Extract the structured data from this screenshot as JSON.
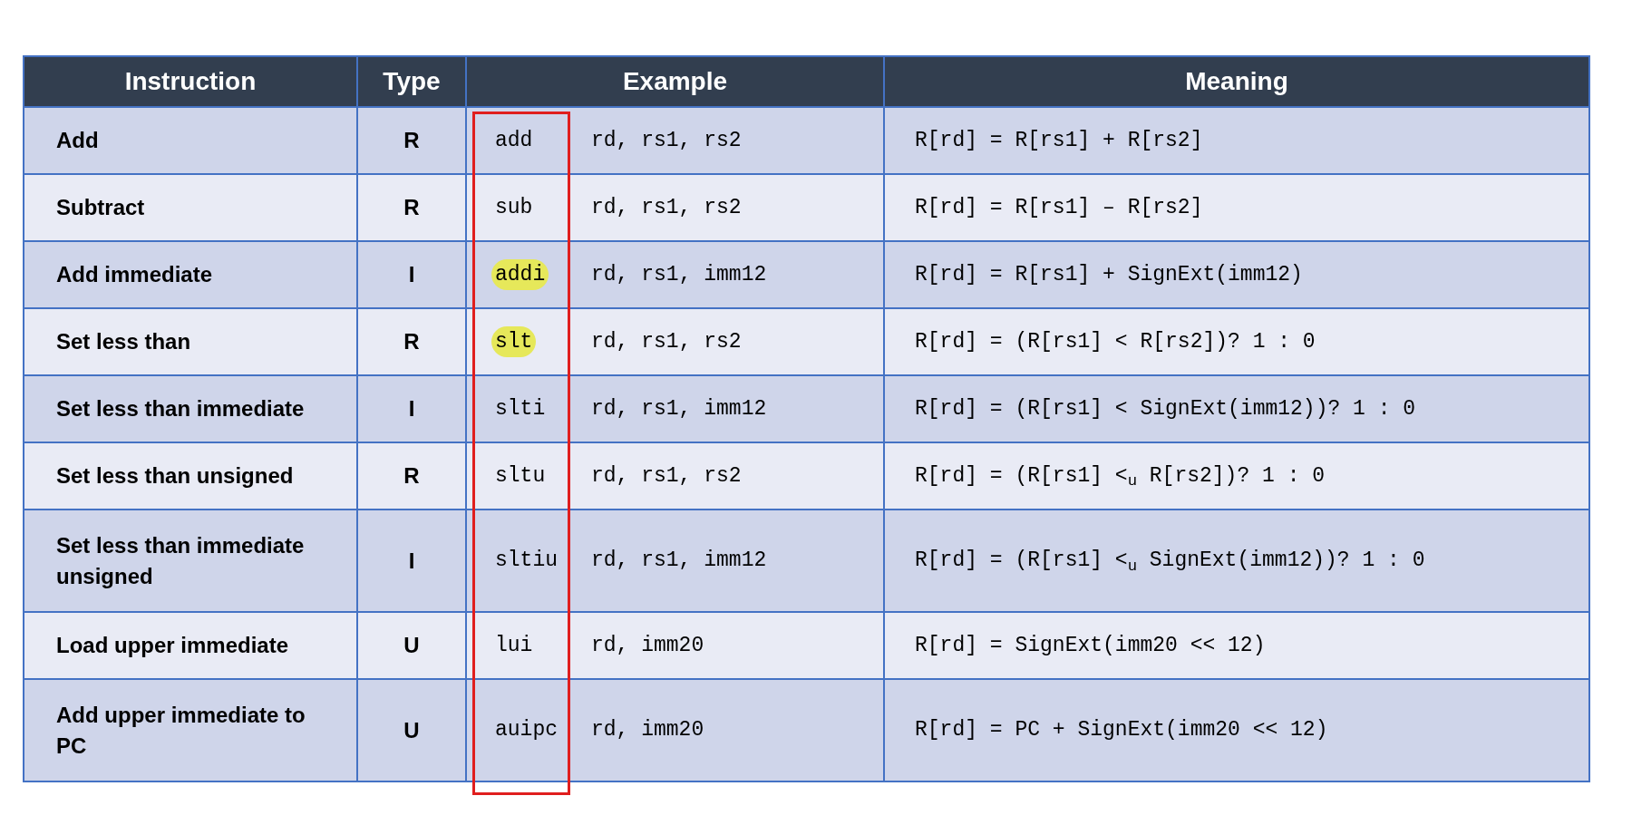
{
  "table": {
    "columns": [
      "Instruction",
      "Type",
      "Example",
      "Meaning"
    ],
    "rows": [
      {
        "instruction": "Add",
        "type": "R",
        "mnemonic": "add",
        "operands": "rd, rs1, rs2",
        "meaning": "R[rd] = R[rs1] + R[rs2]",
        "highlighted": false
      },
      {
        "instruction": "Subtract",
        "type": "R",
        "mnemonic": "sub",
        "operands": "rd, rs1, rs2",
        "meaning": "R[rd] = R[rs1] – R[rs2]",
        "highlighted": false
      },
      {
        "instruction": "Add immediate",
        "type": "I",
        "mnemonic": "addi",
        "operands": "rd, rs1, imm12",
        "meaning": "R[rd] = R[rs1] + SignExt(imm12)",
        "highlighted": true
      },
      {
        "instruction": "Set less than",
        "type": "R",
        "mnemonic": "slt",
        "operands": "rd, rs1, rs2",
        "meaning": "R[rd] = (R[rs1] < R[rs2])? 1 : 0",
        "highlighted": true
      },
      {
        "instruction": "Set less than immediate",
        "type": "I",
        "mnemonic": "slti",
        "operands": "rd, rs1, imm12",
        "meaning": "R[rd] = (R[rs1] < SignExt(imm12))? 1 : 0",
        "highlighted": false
      },
      {
        "instruction": "Set less than unsigned",
        "type": "R",
        "mnemonic": "sltu",
        "operands": "rd, rs1, rs2",
        "meaning": "R[rd] = (R[rs1] <$_{u}$ R[rs2])? 1 : 0",
        "highlighted": false
      },
      {
        "instruction": "Set less than immediate unsigned",
        "type": "I",
        "mnemonic": "sltiu",
        "operands": "rd, rs1, imm12",
        "meaning": "R[rd] = (R[rs1] <$_{u}$ SignExt(imm12))? 1 : 0",
        "highlighted": false
      },
      {
        "instruction": "Load upper immediate",
        "type": "U",
        "mnemonic": "lui",
        "operands": "rd, imm20",
        "meaning": "R[rd] = SignExt(imm20 << 12)",
        "highlighted": false
      },
      {
        "instruction": "Add upper immediate to PC",
        "type": "U",
        "mnemonic": "auipc",
        "operands": "rd, imm20",
        "meaning": "R[rd] = PC + SignExt(imm20 << 12)",
        "highlighted": false
      }
    ]
  },
  "annotations": [
    {
      "kind": "mnemonic-column-box"
    }
  ]
}
